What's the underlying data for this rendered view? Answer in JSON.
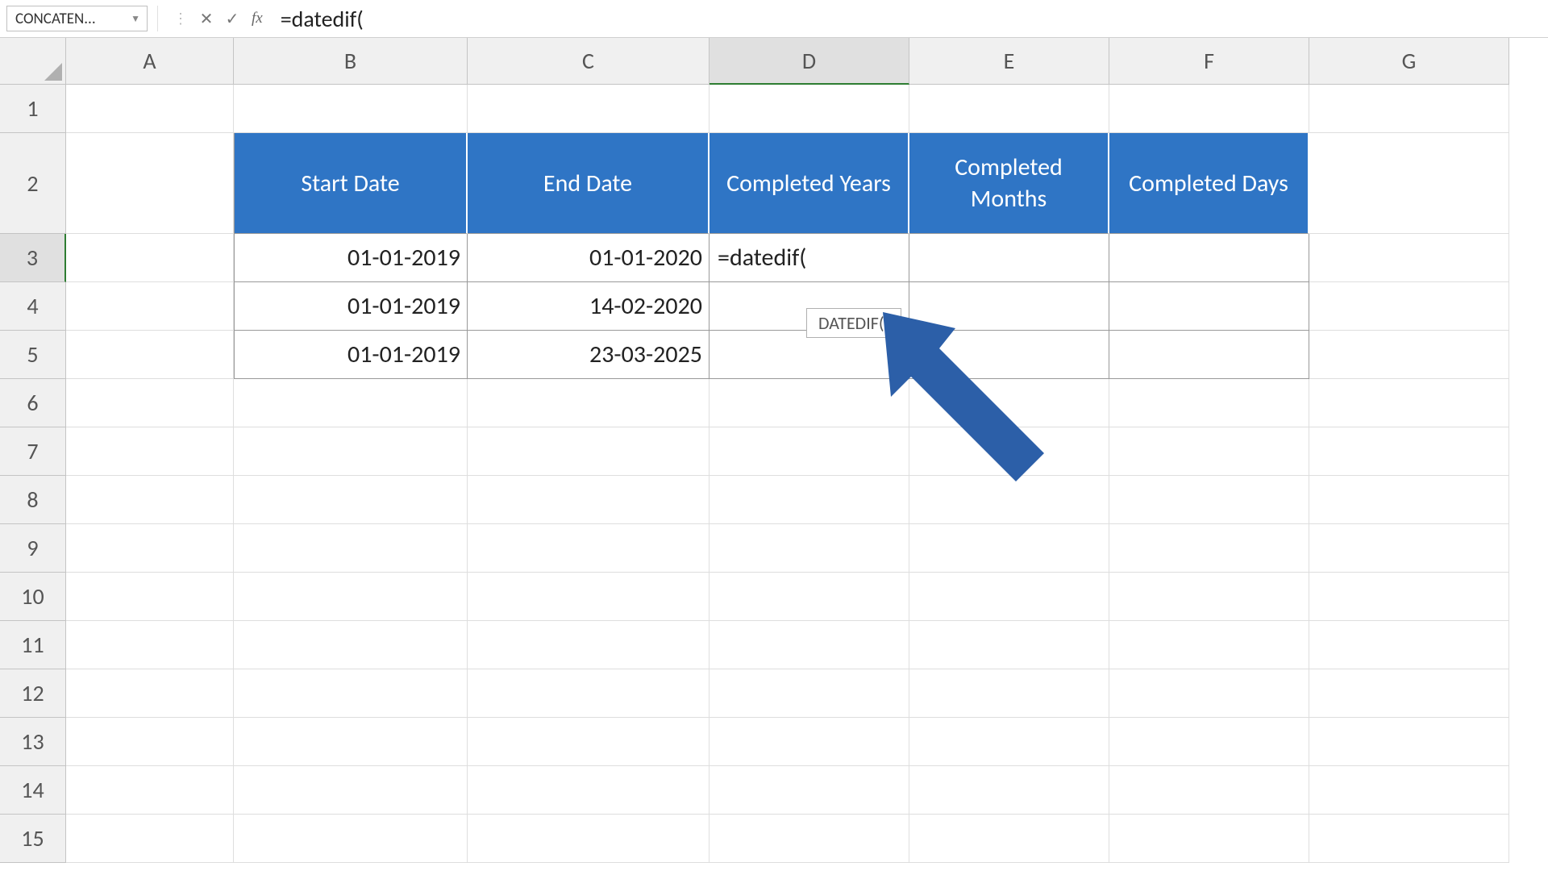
{
  "nameBox": "CONCATEN...",
  "formulaBar": "=datedif(",
  "fxLabel": "fx",
  "columns": [
    "A",
    "B",
    "C",
    "D",
    "E",
    "F",
    "G"
  ],
  "rows": [
    "1",
    "2",
    "3",
    "4",
    "5",
    "6",
    "7",
    "8",
    "9",
    "10",
    "11",
    "12",
    "13",
    "14",
    "15"
  ],
  "activeColumn": "D",
  "activeRow": "3",
  "table": {
    "headers": {
      "startDate": "Start Date",
      "endDate": "End Date",
      "completedYears": "Completed Years",
      "completedMonths": "Completed Months",
      "completedDays": "Completed Days"
    },
    "rows": [
      {
        "start": "01-01-2019",
        "end": "01-01-2020"
      },
      {
        "start": "01-01-2019",
        "end": "14-02-2020"
      },
      {
        "start": "01-01-2019",
        "end": "23-03-2025"
      }
    ]
  },
  "activeCellFormula": "=datedif(",
  "tooltip": "DATEDIF()"
}
